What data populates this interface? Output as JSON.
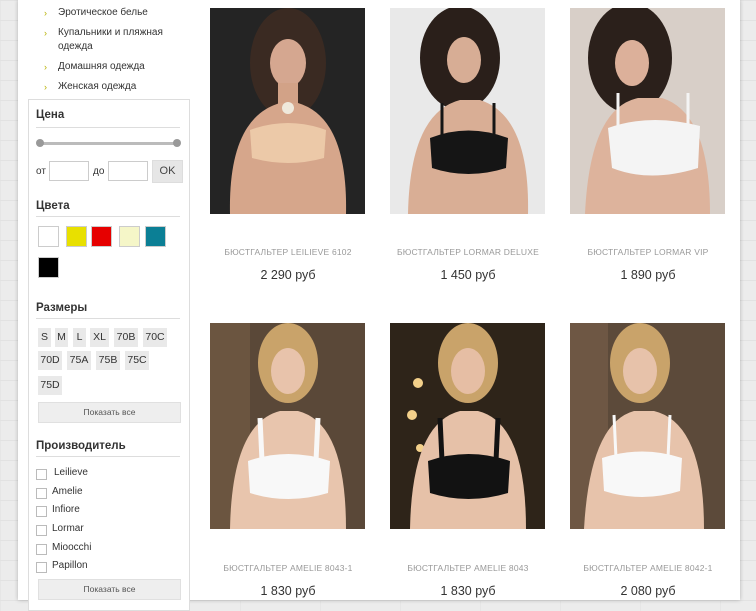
{
  "categories": [
    {
      "label": "Эротическое белье"
    },
    {
      "label": "Купальники и пляжная одежда"
    },
    {
      "label": "Домашняя одежда"
    },
    {
      "label": "Женская одежда"
    }
  ],
  "filters": {
    "price": {
      "title": "Цена",
      "from_label": "от",
      "to_label": "до",
      "from_value": "",
      "to_value": "",
      "ok_label": "OK"
    },
    "colors": {
      "title": "Цвета",
      "swatches": [
        "#ffffff",
        "#e8e000",
        "#e60000",
        "#f5f6c8",
        "#0b7f95",
        "#000000"
      ]
    },
    "sizes": {
      "title": "Размеры",
      "items": [
        "S",
        "M",
        "L",
        "XL",
        "70B",
        "70C",
        "70D",
        "75A",
        "75B",
        "75C",
        "75D"
      ],
      "show_all": "Показать все"
    },
    "maker": {
      "title": "Производитель",
      "items": [
        "Leilieve",
        "Amelie",
        "Infiore",
        "Lormar",
        "Mioocchi",
        "Papillon"
      ],
      "show_all": "Показать все"
    }
  },
  "products": [
    {
      "name": "БЮСТГАЛЬТЕР LEILIEVE 6102",
      "price": "2 290 руб"
    },
    {
      "name": "БЮСТГАЛЬТЕР LORMAR DELUXE",
      "price": "1 450 руб"
    },
    {
      "name": "БЮСТГАЛЬТЕР LORMAR VIP",
      "price": "1 890 руб"
    },
    {
      "name": "БЮСТГАЛЬТЕР AMELIE 8043-1",
      "price": "1 830 руб"
    },
    {
      "name": "БЮСТГАЛЬТЕР AMELIE 8043",
      "price": "1 830 руб"
    },
    {
      "name": "БЮСТГАЛЬТЕР AMELIE 8042-1",
      "price": "2 080 руб"
    }
  ]
}
